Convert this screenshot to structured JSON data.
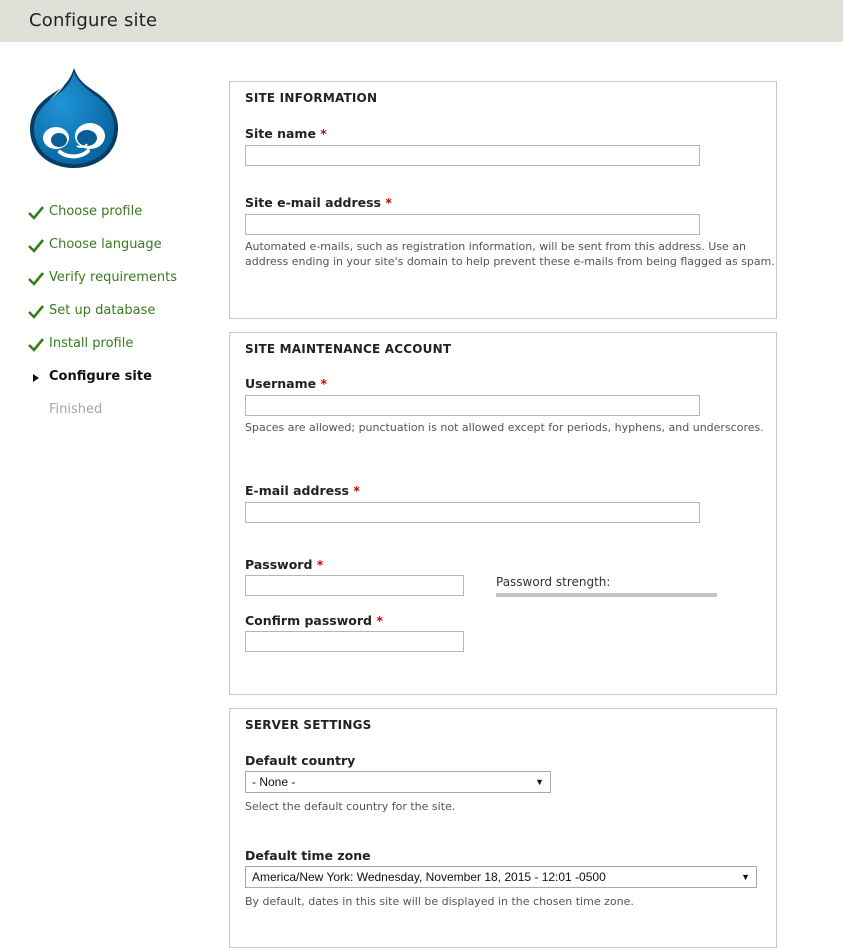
{
  "header": {
    "title": "Configure site"
  },
  "sidebar": {
    "steps": [
      {
        "label": "Choose profile",
        "state": "done"
      },
      {
        "label": "Choose language",
        "state": "done"
      },
      {
        "label": "Verify requirements",
        "state": "done"
      },
      {
        "label": "Set up database",
        "state": "done"
      },
      {
        "label": "Install profile",
        "state": "done"
      },
      {
        "label": "Configure site",
        "state": "active"
      },
      {
        "label": "Finished",
        "state": "todo"
      }
    ]
  },
  "site_information": {
    "legend": "SITE INFORMATION",
    "site_name_label": "Site name",
    "site_name_value": "",
    "site_email_label": "Site e-mail address",
    "site_email_value": "",
    "site_email_desc": "Automated e-mails, such as registration information, will be sent from this address. Use an address ending in your site's domain to help prevent these e-mails from being flagged as spam."
  },
  "maintenance_account": {
    "legend": "SITE MAINTENANCE ACCOUNT",
    "username_label": "Username",
    "username_value": "",
    "username_desc": "Spaces are allowed; punctuation is not allowed except for periods, hyphens, and underscores.",
    "email_label": "E-mail address",
    "email_value": "",
    "password_label": "Password",
    "password_value": "",
    "strength_label": "Password strength:",
    "confirm_label": "Confirm password",
    "confirm_value": ""
  },
  "server_settings": {
    "legend": "SERVER SETTINGS",
    "country_label": "Default country",
    "country_selected": "- None -",
    "country_desc": "Select the default country for the site.",
    "timezone_label": "Default time zone",
    "timezone_selected": "America/New York: Wednesday, November 18, 2015 - 12:01 -0500",
    "timezone_desc": "By default, dates in this site will be displayed in the chosen time zone."
  },
  "required_marker": "*",
  "colors": {
    "header_bg": "#e1e0d8",
    "done_step": "#3a7b1e",
    "required": "#d00000",
    "logo_blue": "#0c76b8"
  },
  "icons": {
    "logo": "drupal-drop-icon",
    "done": "check-icon",
    "active": "triangle-right-icon"
  }
}
